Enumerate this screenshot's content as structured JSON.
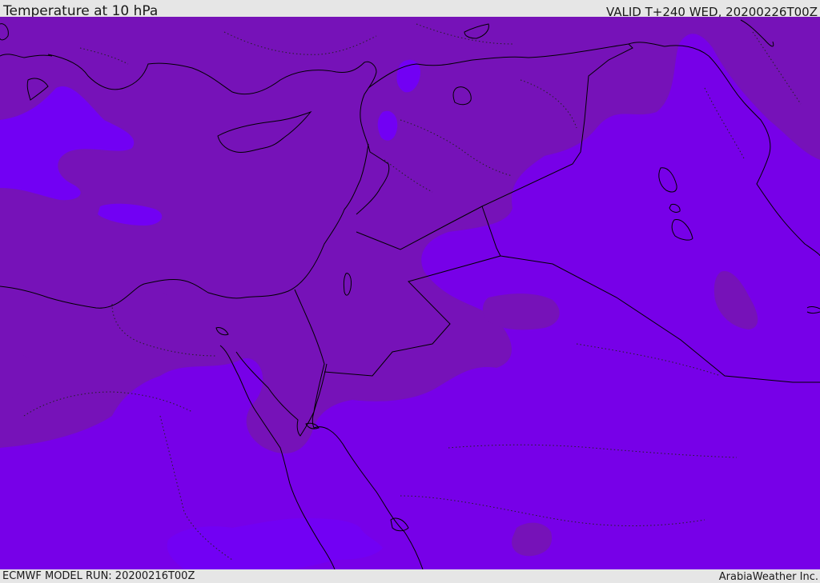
{
  "header": {
    "title": "Temperature at 10 hPa",
    "valid": "VALID T+240 WED, 20200226T00Z"
  },
  "footer": {
    "model_run": "ECMWF MODEL RUN: 20200216T00Z",
    "credit": "ArabiaWeather Inc."
  },
  "map": {
    "colors": {
      "background_fill": "#7c00da",
      "warmer_band": "#7612b8",
      "cooler_band": "#7200f4",
      "coastline": "#000000",
      "border": "#000000"
    }
  }
}
